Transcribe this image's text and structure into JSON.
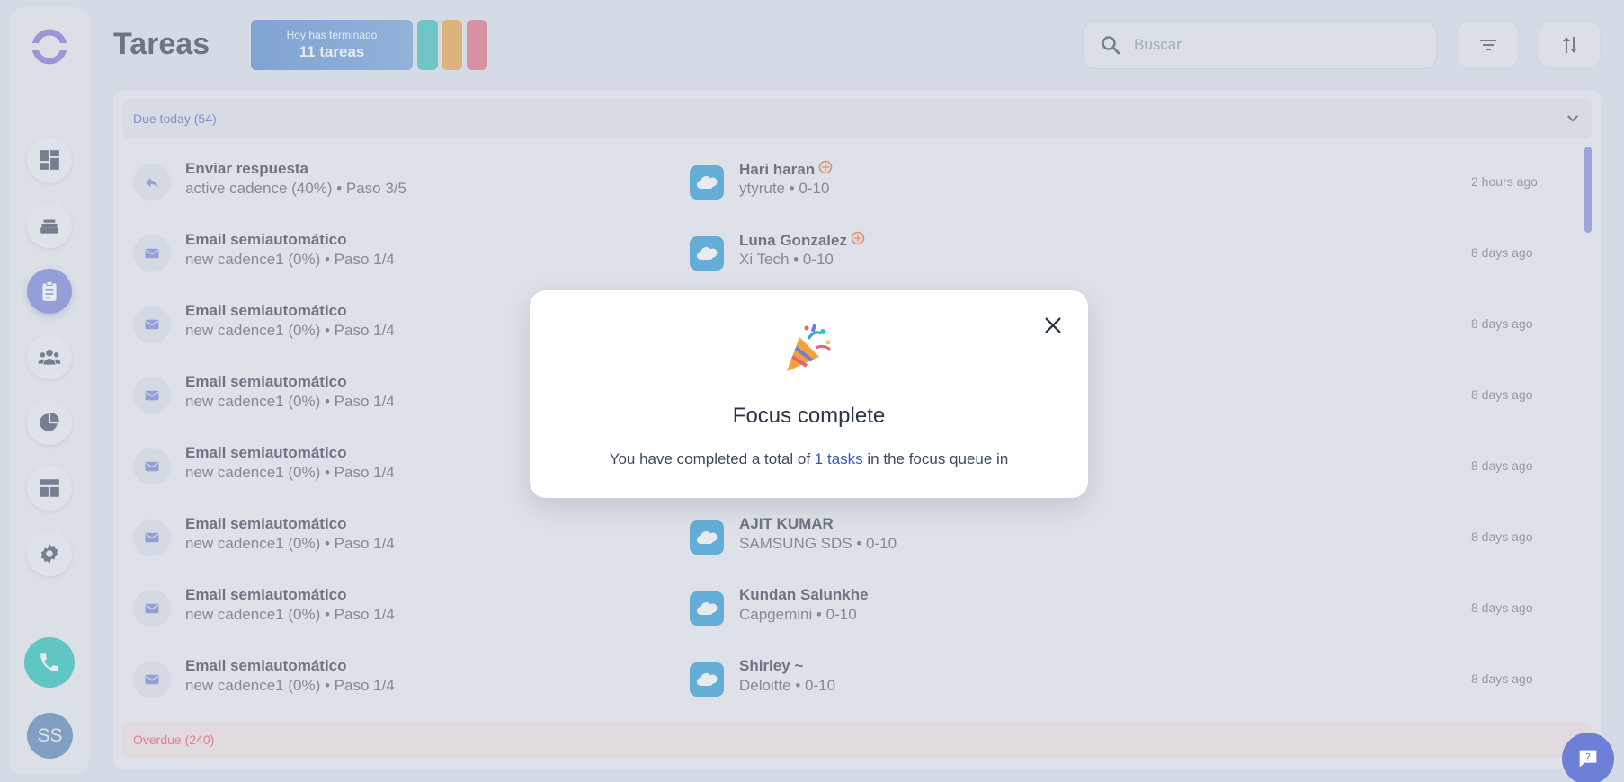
{
  "header": {
    "title": "Tareas",
    "done_line1": "Hoy has terminado",
    "done_line2": "11 tareas",
    "search_placeholder": "Buscar",
    "search_value": ""
  },
  "sidebar": {
    "items": [
      "dashboard-icon",
      "inbox-stack-icon",
      "tasks-clipboard-icon",
      "contacts-group-icon",
      "reports-pie-icon",
      "layout-icon",
      "settings-gear-icon"
    ],
    "active_index": 2,
    "avatar_initials": "SS"
  },
  "sections": {
    "due_today": "Due today (54)",
    "overdue": "Overdue (240)"
  },
  "tasks": [
    {
      "type": "reply-icon",
      "title": "Enviar respuesta",
      "subtitle": "active cadence (40%) • Paso 3/5",
      "contact": "Hari haran",
      "flag": true,
      "company": "ytyrute • 0-10",
      "time": "2 hours ago"
    },
    {
      "type": "mail-icon",
      "title": "Email semiautomático",
      "subtitle": "new cadence1 (0%) • Paso 1/4",
      "contact": "Luna Gonzalez",
      "flag": true,
      "company": "Xi Tech • 0-10",
      "time": "8 days ago"
    },
    {
      "type": "mail-icon",
      "title": "Email semiautomático",
      "subtitle": "new cadence1 (0%) • Paso 1/4",
      "contact": "",
      "flag": false,
      "company": "",
      "time": "8 days ago"
    },
    {
      "type": "mail-icon",
      "title": "Email semiautomático",
      "subtitle": "new cadence1 (0%) • Paso 1/4",
      "contact": "",
      "flag": false,
      "company": "",
      "time": "8 days ago"
    },
    {
      "type": "mail-icon",
      "title": "Email semiautomático",
      "subtitle": "new cadence1 (0%) • Paso 1/4",
      "contact": "",
      "flag": false,
      "company": "",
      "time": "8 days ago"
    },
    {
      "type": "mail-icon",
      "title": "Email semiautomático",
      "subtitle": "new cadence1 (0%) • Paso 1/4",
      "contact": "AJIT KUMAR",
      "flag": false,
      "company": "SAMSUNG SDS • 0-10",
      "time": "8 days ago"
    },
    {
      "type": "mail-icon",
      "title": "Email semiautomático",
      "subtitle": "new cadence1 (0%) • Paso 1/4",
      "contact": "Kundan Salunkhe",
      "flag": false,
      "company": "Capgemini • 0-10",
      "time": "8 days ago"
    },
    {
      "type": "mail-icon",
      "title": "Email semiautomático",
      "subtitle": "new cadence1 (0%) • Paso 1/4",
      "contact": "Shirley ~",
      "flag": false,
      "company": "Deloitte • 0-10",
      "time": "8 days ago"
    }
  ],
  "modal": {
    "title": "Focus complete",
    "text_before": "You have completed a total of",
    "text_highlight": "1 tasks",
    "text_after": "in the focus queue in"
  },
  "colors": {
    "accent": "#6f7fd8",
    "teal": "#33c2b9",
    "orange": "#eaa23a",
    "pink": "#e4647f",
    "salesforce": "#1b96d6",
    "overdue": "#e2525c"
  }
}
